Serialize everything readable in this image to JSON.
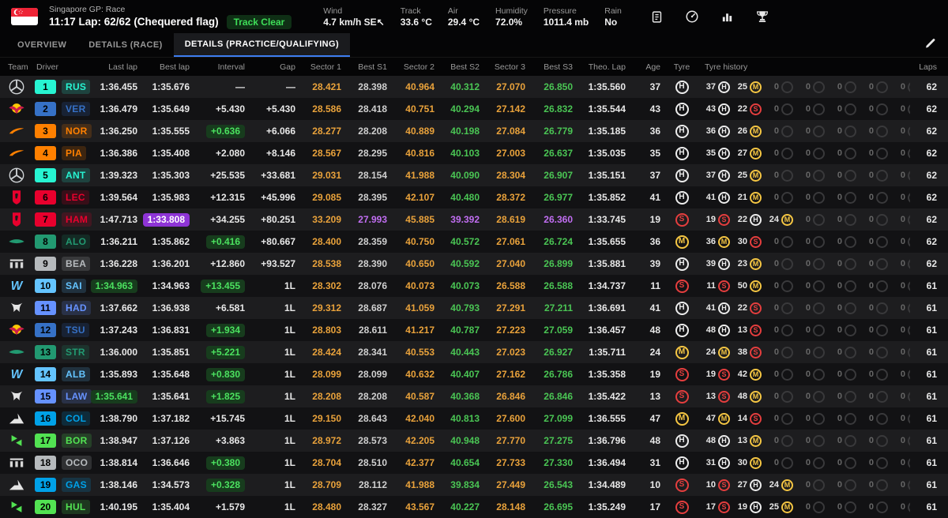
{
  "header": {
    "event": "Singapore GP: Race",
    "status_line": "11:17 Lap: 62/62 (Chequered flag)",
    "track_status": "Track Clear",
    "weather": [
      {
        "label": "Wind",
        "value": "4.7 km/h SE↖"
      },
      {
        "label": "Track",
        "value": "33.6 °C"
      },
      {
        "label": "Air",
        "value": "29.4 °C"
      },
      {
        "label": "Humidity",
        "value": "72.0%"
      },
      {
        "label": "Pressure",
        "value": "1011.4 mb"
      },
      {
        "label": "Rain",
        "value": "No"
      }
    ],
    "toolbar_icons": [
      "report-icon",
      "gauge-icon",
      "chart-icon",
      "trophy-icon"
    ]
  },
  "tabs": [
    {
      "label": "OVERVIEW",
      "active": false
    },
    {
      "label": "DETAILS (RACE)",
      "active": false
    },
    {
      "label": "DETAILS (PRACTICE/QUALIFYING)",
      "active": true
    }
  ],
  "colors": {
    "sector": "#e9a23b",
    "personal_best": "#4ac554",
    "overall_best": "#c16ef2",
    "badge_green_bg": "#173c1d",
    "badge_green_text": "#4be15f",
    "badge_purple_bg": "#8e34d6",
    "track_clear": "#3ede58",
    "active_tab_accent": "#3d7df0",
    "tyre_hard": "#ededed",
    "tyre_medium": "#f5c643",
    "tyre_soft": "#e53e3e"
  },
  "table": {
    "columns": [
      "Team",
      "Driver",
      "Last lap",
      "Best lap",
      "Interval",
      "Gap",
      "Sector 1",
      "Best S1",
      "Sector 2",
      "Best S2",
      "Sector 3",
      "Best S3",
      "Theo. Lap",
      "Age",
      "Tyre",
      "Tyre history",
      "Laps"
    ],
    "rows": [
      {
        "pos": "1",
        "code": "RUS",
        "team": "Mercedes",
        "team_key": "mercedes",
        "color": "#27F4D2",
        "last": "1:36.455",
        "last_badge": false,
        "best": "1:35.676",
        "best_badge": false,
        "interval": "—",
        "interval_badge": false,
        "gap": "—",
        "s1": "28.421",
        "bs1": "28.398",
        "s2": "40.964",
        "bs2": "40.312",
        "s3": "27.070",
        "bs3": "26.850",
        "purple_best": false,
        "theo": "1:35.560",
        "age": "37",
        "tyre": "H",
        "history": [
          [
            "37",
            "H"
          ],
          [
            "25",
            "M"
          ]
        ],
        "laps": "62"
      },
      {
        "pos": "2",
        "code": "VER",
        "team": "Red Bull",
        "team_key": "redbull",
        "color": "#3671C6",
        "last": "1:36.479",
        "last_badge": false,
        "best": "1:35.649",
        "best_badge": false,
        "interval": "+5.430",
        "interval_badge": false,
        "gap": "+5.430",
        "s1": "28.586",
        "bs1": "28.418",
        "s2": "40.751",
        "bs2": "40.294",
        "s3": "27.142",
        "bs3": "26.832",
        "purple_best": false,
        "theo": "1:35.544",
        "age": "43",
        "tyre": "H",
        "history": [
          [
            "43",
            "H"
          ],
          [
            "22",
            "S"
          ]
        ],
        "laps": "62"
      },
      {
        "pos": "3",
        "code": "NOR",
        "team": "McLaren",
        "team_key": "mclaren",
        "color": "#FF8000",
        "last": "1:36.250",
        "last_badge": false,
        "best": "1:35.555",
        "best_badge": false,
        "interval": "+0.636",
        "interval_badge": true,
        "gap": "+6.066",
        "s1": "28.277",
        "bs1": "28.208",
        "s2": "40.889",
        "bs2": "40.198",
        "s3": "27.084",
        "bs3": "26.779",
        "purple_best": false,
        "theo": "1:35.185",
        "age": "36",
        "tyre": "H",
        "history": [
          [
            "36",
            "H"
          ],
          [
            "26",
            "M"
          ]
        ],
        "laps": "62"
      },
      {
        "pos": "4",
        "code": "PIA",
        "team": "McLaren",
        "team_key": "mclaren",
        "color": "#FF8000",
        "last": "1:36.386",
        "last_badge": false,
        "best": "1:35.408",
        "best_badge": false,
        "interval": "+2.080",
        "interval_badge": false,
        "gap": "+8.146",
        "s1": "28.567",
        "bs1": "28.295",
        "s2": "40.816",
        "bs2": "40.103",
        "s3": "27.003",
        "bs3": "26.637",
        "purple_best": false,
        "theo": "1:35.035",
        "age": "35",
        "tyre": "H",
        "history": [
          [
            "35",
            "H"
          ],
          [
            "27",
            "M"
          ]
        ],
        "laps": "62"
      },
      {
        "pos": "5",
        "code": "ANT",
        "team": "Mercedes",
        "team_key": "mercedes",
        "color": "#27F4D2",
        "last": "1:39.323",
        "last_badge": false,
        "best": "1:35.303",
        "best_badge": false,
        "interval": "+25.535",
        "interval_badge": false,
        "gap": "+33.681",
        "s1": "29.031",
        "bs1": "28.154",
        "s2": "41.988",
        "bs2": "40.090",
        "s3": "28.304",
        "bs3": "26.907",
        "purple_best": false,
        "theo": "1:35.151",
        "age": "37",
        "tyre": "H",
        "history": [
          [
            "37",
            "H"
          ],
          [
            "25",
            "M"
          ]
        ],
        "laps": "62"
      },
      {
        "pos": "6",
        "code": "LEC",
        "team": "Ferrari",
        "team_key": "ferrari",
        "color": "#E8002D",
        "last": "1:39.564",
        "last_badge": false,
        "best": "1:35.983",
        "best_badge": false,
        "interval": "+12.315",
        "interval_badge": false,
        "gap": "+45.996",
        "s1": "29.085",
        "bs1": "28.395",
        "s2": "42.107",
        "bs2": "40.480",
        "s3": "28.372",
        "bs3": "26.977",
        "purple_best": false,
        "theo": "1:35.852",
        "age": "41",
        "tyre": "H",
        "history": [
          [
            "41",
            "H"
          ],
          [
            "21",
            "M"
          ]
        ],
        "laps": "62"
      },
      {
        "pos": "7",
        "code": "HAM",
        "team": "Ferrari",
        "team_key": "ferrari",
        "color": "#E8002D",
        "last": "1:47.713",
        "last_badge": false,
        "best": "1:33.808",
        "best_badge": true,
        "interval": "+34.255",
        "interval_badge": false,
        "gap": "+80.251",
        "s1": "33.209",
        "bs1": "27.993",
        "s2": "45.885",
        "bs2": "39.392",
        "s3": "28.619",
        "bs3": "26.360",
        "purple_best": true,
        "theo": "1:33.745",
        "age": "19",
        "tyre": "S",
        "history": [
          [
            "19",
            "S"
          ],
          [
            "22",
            "H"
          ],
          [
            "24",
            "M"
          ]
        ],
        "laps": "62"
      },
      {
        "pos": "8",
        "code": "ALO",
        "team": "Aston Martin",
        "team_key": "astonmartin",
        "color": "#229971",
        "last": "1:36.211",
        "last_badge": false,
        "best": "1:35.862",
        "best_badge": false,
        "interval": "+0.416",
        "interval_badge": true,
        "gap": "+80.667",
        "s1": "28.400",
        "bs1": "28.359",
        "s2": "40.750",
        "bs2": "40.572",
        "s3": "27.061",
        "bs3": "26.724",
        "purple_best": false,
        "theo": "1:35.655",
        "age": "36",
        "tyre": "M",
        "history": [
          [
            "36",
            "M"
          ],
          [
            "30",
            "S"
          ]
        ],
        "laps": "62"
      },
      {
        "pos": "9",
        "code": "BEA",
        "team": "Haas",
        "team_key": "haas",
        "color": "#B6BABD",
        "last": "1:36.228",
        "last_badge": false,
        "best": "1:36.201",
        "best_badge": false,
        "interval": "+12.860",
        "interval_badge": false,
        "gap": "+93.527",
        "s1": "28.538",
        "bs1": "28.390",
        "s2": "40.650",
        "bs2": "40.592",
        "s3": "27.040",
        "bs3": "26.899",
        "purple_best": false,
        "theo": "1:35.881",
        "age": "39",
        "tyre": "H",
        "history": [
          [
            "39",
            "H"
          ],
          [
            "23",
            "M"
          ]
        ],
        "laps": "62"
      },
      {
        "pos": "10",
        "code": "SAI",
        "team": "Williams",
        "team_key": "williams",
        "color": "#64C4FF",
        "last": "1:34.963",
        "last_badge": true,
        "best": "1:34.963",
        "best_badge": false,
        "interval": "+13.455",
        "interval_badge": true,
        "gap": "1L",
        "s1": "28.302",
        "bs1": "28.076",
        "s2": "40.073",
        "bs2": "40.073",
        "s3": "26.588",
        "bs3": "26.588",
        "purple_best": false,
        "theo": "1:34.737",
        "age": "11",
        "tyre": "S",
        "history": [
          [
            "11",
            "S"
          ],
          [
            "50",
            "M"
          ]
        ],
        "laps": "61"
      },
      {
        "pos": "11",
        "code": "HAD",
        "team": "Racing Bulls",
        "team_key": "racingbulls",
        "color": "#6692FF",
        "last": "1:37.662",
        "last_badge": false,
        "best": "1:36.938",
        "best_badge": false,
        "interval": "+6.581",
        "interval_badge": false,
        "gap": "1L",
        "s1": "29.312",
        "bs1": "28.687",
        "s2": "41.059",
        "bs2": "40.793",
        "s3": "27.291",
        "bs3": "27.211",
        "purple_best": false,
        "theo": "1:36.691",
        "age": "41",
        "tyre": "H",
        "history": [
          [
            "41",
            "H"
          ],
          [
            "22",
            "S"
          ]
        ],
        "laps": "61"
      },
      {
        "pos": "12",
        "code": "TSU",
        "team": "Red Bull",
        "team_key": "redbull",
        "color": "#3671C6",
        "last": "1:37.243",
        "last_badge": false,
        "best": "1:36.831",
        "best_badge": false,
        "interval": "+1.934",
        "interval_badge": true,
        "gap": "1L",
        "s1": "28.803",
        "bs1": "28.611",
        "s2": "41.217",
        "bs2": "40.787",
        "s3": "27.223",
        "bs3": "27.059",
        "purple_best": false,
        "theo": "1:36.457",
        "age": "48",
        "tyre": "H",
        "history": [
          [
            "48",
            "H"
          ],
          [
            "13",
            "S"
          ]
        ],
        "laps": "61"
      },
      {
        "pos": "13",
        "code": "STR",
        "team": "Aston Martin",
        "team_key": "astonmartin",
        "color": "#229971",
        "last": "1:36.000",
        "last_badge": false,
        "best": "1:35.851",
        "best_badge": false,
        "interval": "+5.221",
        "interval_badge": true,
        "gap": "1L",
        "s1": "28.424",
        "bs1": "28.341",
        "s2": "40.553",
        "bs2": "40.443",
        "s3": "27.023",
        "bs3": "26.927",
        "purple_best": false,
        "theo": "1:35.711",
        "age": "24",
        "tyre": "M",
        "history": [
          [
            "24",
            "M"
          ],
          [
            "38",
            "S"
          ]
        ],
        "laps": "61"
      },
      {
        "pos": "14",
        "code": "ALB",
        "team": "Williams",
        "team_key": "williams",
        "color": "#64C4FF",
        "last": "1:35.893",
        "last_badge": false,
        "best": "1:35.648",
        "best_badge": false,
        "interval": "+0.830",
        "interval_badge": true,
        "gap": "1L",
        "s1": "28.099",
        "bs1": "28.099",
        "s2": "40.632",
        "bs2": "40.407",
        "s3": "27.162",
        "bs3": "26.786",
        "purple_best": false,
        "theo": "1:35.358",
        "age": "19",
        "tyre": "S",
        "history": [
          [
            "19",
            "S"
          ],
          [
            "42",
            "M"
          ]
        ],
        "laps": "61"
      },
      {
        "pos": "15",
        "code": "LAW",
        "team": "Racing Bulls",
        "team_key": "racingbulls",
        "color": "#6692FF",
        "last": "1:35.641",
        "last_badge": true,
        "best": "1:35.641",
        "best_badge": false,
        "interval": "+1.825",
        "interval_badge": true,
        "gap": "1L",
        "s1": "28.208",
        "bs1": "28.208",
        "s2": "40.587",
        "bs2": "40.368",
        "s3": "26.846",
        "bs3": "26.846",
        "purple_best": false,
        "theo": "1:35.422",
        "age": "13",
        "tyre": "S",
        "history": [
          [
            "13",
            "S"
          ],
          [
            "48",
            "M"
          ]
        ],
        "laps": "61"
      },
      {
        "pos": "16",
        "code": "COL",
        "team": "Alpine",
        "team_key": "alpine",
        "color": "#00A1E8",
        "last": "1:38.790",
        "last_badge": false,
        "best": "1:37.182",
        "best_badge": false,
        "interval": "+15.745",
        "interval_badge": false,
        "gap": "1L",
        "s1": "29.150",
        "bs1": "28.643",
        "s2": "42.040",
        "bs2": "40.813",
        "s3": "27.600",
        "bs3": "27.099",
        "purple_best": false,
        "theo": "1:36.555",
        "age": "47",
        "tyre": "M",
        "history": [
          [
            "47",
            "M"
          ],
          [
            "14",
            "S"
          ]
        ],
        "laps": "61"
      },
      {
        "pos": "17",
        "code": "BOR",
        "team": "Sauber",
        "team_key": "sauber",
        "color": "#52E252",
        "last": "1:38.947",
        "last_badge": false,
        "best": "1:37.126",
        "best_badge": false,
        "interval": "+3.863",
        "interval_badge": false,
        "gap": "1L",
        "s1": "28.972",
        "bs1": "28.573",
        "s2": "42.205",
        "bs2": "40.948",
        "s3": "27.770",
        "bs3": "27.275",
        "purple_best": false,
        "theo": "1:36.796",
        "age": "48",
        "tyre": "H",
        "history": [
          [
            "48",
            "H"
          ],
          [
            "13",
            "M"
          ]
        ],
        "laps": "61"
      },
      {
        "pos": "18",
        "code": "OCO",
        "team": "Haas",
        "team_key": "haas",
        "color": "#B6BABD",
        "last": "1:38.814",
        "last_badge": false,
        "best": "1:36.646",
        "best_badge": false,
        "interval": "+0.380",
        "interval_badge": true,
        "gap": "1L",
        "s1": "28.704",
        "bs1": "28.510",
        "s2": "42.377",
        "bs2": "40.654",
        "s3": "27.733",
        "bs3": "27.330",
        "purple_best": false,
        "theo": "1:36.494",
        "age": "31",
        "tyre": "H",
        "history": [
          [
            "31",
            "H"
          ],
          [
            "30",
            "M"
          ]
        ],
        "laps": "61"
      },
      {
        "pos": "19",
        "code": "GAS",
        "team": "Alpine",
        "team_key": "alpine",
        "color": "#00A1E8",
        "last": "1:38.146",
        "last_badge": false,
        "best": "1:34.573",
        "best_badge": false,
        "interval": "+0.328",
        "interval_badge": true,
        "gap": "1L",
        "s1": "28.709",
        "bs1": "28.112",
        "s2": "41.988",
        "bs2": "39.834",
        "s3": "27.449",
        "bs3": "26.543",
        "purple_best": false,
        "theo": "1:34.489",
        "age": "10",
        "tyre": "S",
        "history": [
          [
            "10",
            "S"
          ],
          [
            "27",
            "H"
          ],
          [
            "24",
            "M"
          ]
        ],
        "laps": "61"
      },
      {
        "pos": "20",
        "code": "HUL",
        "team": "Sauber",
        "team_key": "sauber",
        "color": "#52E252",
        "last": "1:40.195",
        "last_badge": false,
        "best": "1:35.404",
        "best_badge": false,
        "interval": "+1.579",
        "interval_badge": false,
        "gap": "1L",
        "s1": "28.480",
        "bs1": "28.327",
        "s2": "43.567",
        "bs2": "40.227",
        "s3": "28.148",
        "bs3": "26.695",
        "purple_best": false,
        "theo": "1:35.249",
        "age": "17",
        "tyre": "S",
        "history": [
          [
            "17",
            "S"
          ],
          [
            "19",
            "H"
          ],
          [
            "25",
            "M"
          ]
        ],
        "laps": "61"
      }
    ]
  }
}
